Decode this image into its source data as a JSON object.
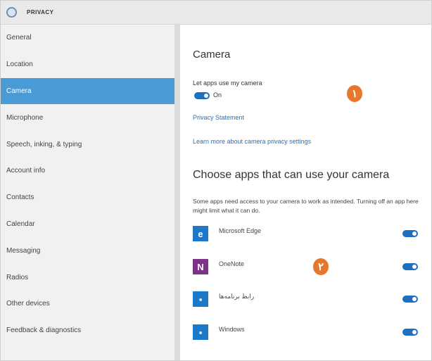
{
  "window": {
    "title": "PRIVACY"
  },
  "sidebar": {
    "items": [
      {
        "label": "General",
        "active": false
      },
      {
        "label": "Location",
        "active": false
      },
      {
        "label": "Camera",
        "active": true
      },
      {
        "label": "Microphone",
        "active": false
      },
      {
        "label": "Speech, inking, & typing",
        "active": false
      },
      {
        "label": "Account info",
        "active": false
      },
      {
        "label": "Contacts",
        "active": false
      },
      {
        "label": "Calendar",
        "active": false
      },
      {
        "label": "Messaging",
        "active": false
      },
      {
        "label": "Radios",
        "active": false
      },
      {
        "label": "Other devices",
        "active": false
      },
      {
        "label": "Feedback & diagnostics",
        "active": false
      }
    ]
  },
  "main": {
    "title": "Camera",
    "setting_label": "Let apps use my camera",
    "toggle_state": "On",
    "privacy_link": "Privacy Statement",
    "learn_link": "Learn more about camera privacy settings",
    "section_title": "Choose apps that can use your camera",
    "section_desc": "Some apps need access to your camera to work as intended. Turning off an app here might limit what it can do.",
    "apps": [
      {
        "name": "Microsoft Edge",
        "icon_text": "e",
        "color": "#1c78c9"
      },
      {
        "name": "OneNote",
        "icon_text": "N",
        "color": "#7b3486"
      },
      {
        "name": "رابط برنامه‌ها",
        "icon_text": "▪",
        "color": "#1c78c9"
      },
      {
        "name": "Windows",
        "icon_text": "▪",
        "color": "#1c78c9"
      }
    ]
  },
  "badges": {
    "one": "۱",
    "two": "۲"
  },
  "colors": {
    "accent": "#4a9ad6",
    "toggle_on": "#1f6fc1",
    "badge": "#e8772e",
    "link": "#2b6fb7"
  }
}
